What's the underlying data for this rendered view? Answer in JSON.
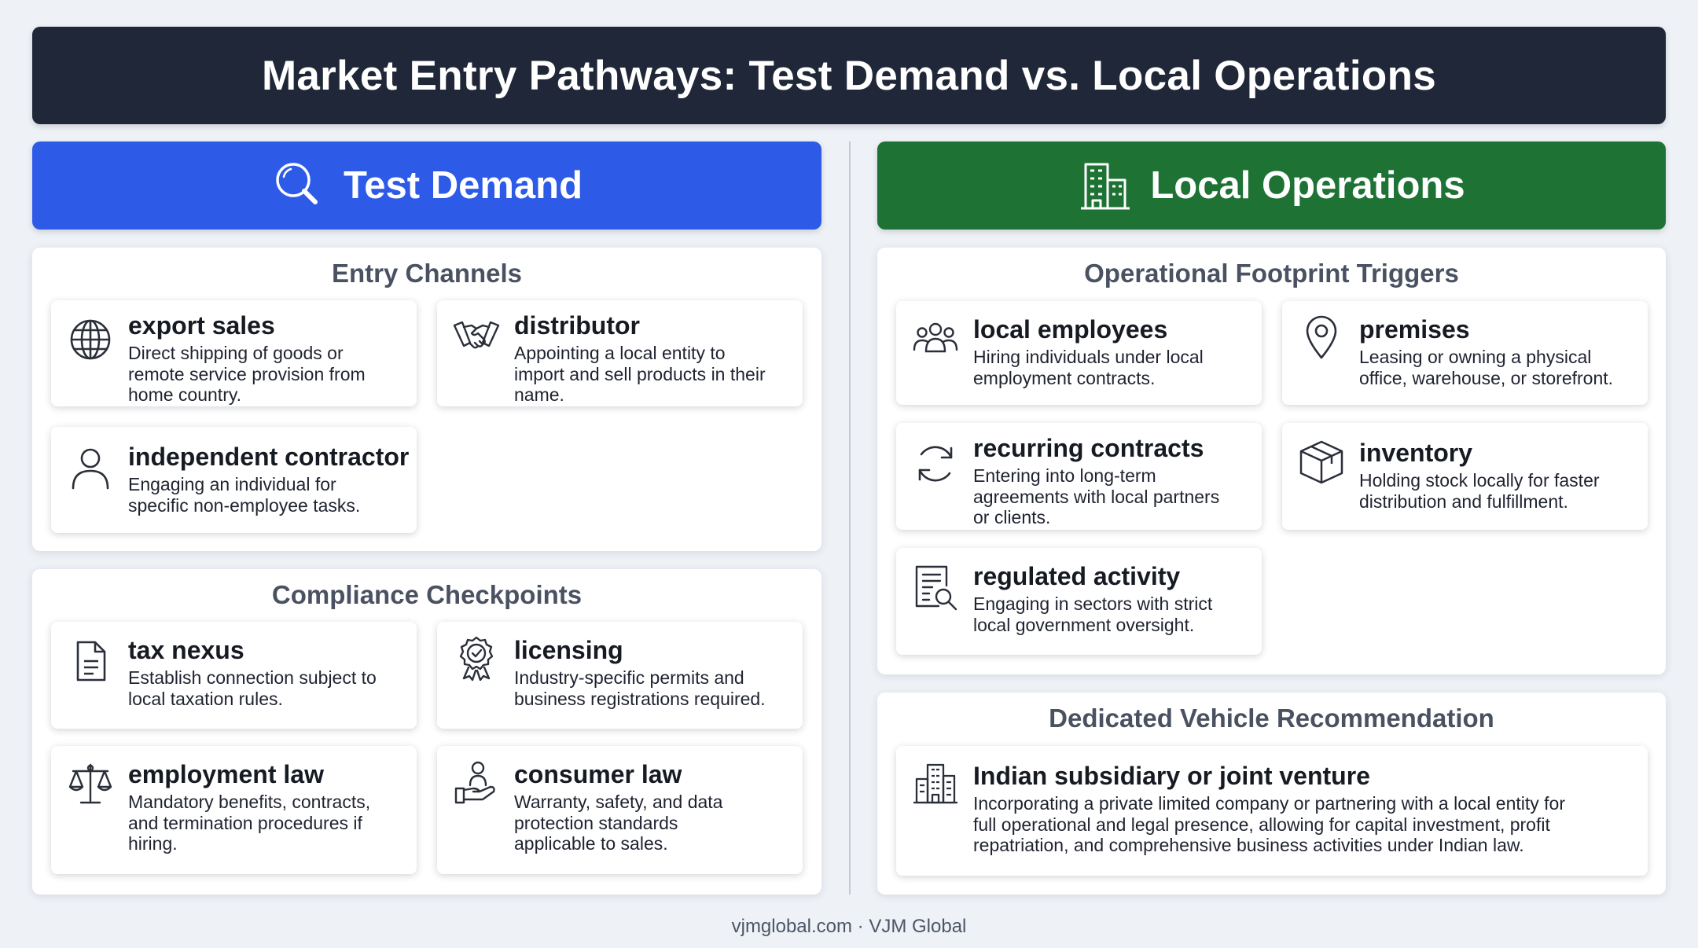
{
  "title": "Market Entry Pathways: Test Demand vs. Local Operations",
  "left_column": {
    "header": "Test Demand",
    "header_icon": "search-icon",
    "header_color": "#2d5be8",
    "entry_channels": {
      "title": "Entry Channels",
      "cards": [
        {
          "icon": "globe-icon",
          "title": "export sales",
          "lines": [
            "Direct shipping of goods or",
            "remote service provision from",
            "home country."
          ]
        },
        {
          "icon": "handshake-icon",
          "title": "distributor",
          "lines": [
            "Appointing a local entity to",
            "import and sell products in their",
            "name."
          ]
        },
        {
          "icon": "person-icon",
          "title": "independent contractor",
          "lines": [
            "Engaging an individual for",
            "specific non-employee tasks."
          ]
        }
      ]
    },
    "compliance_checkpoints": {
      "title": "Compliance Checkpoints",
      "cards": [
        {
          "icon": "document-icon",
          "title": "tax nexus",
          "lines": [
            "Establish connection subject to",
            "local taxation rules."
          ]
        },
        {
          "icon": "badge-icon",
          "title": "licensing",
          "lines": [
            "Industry-specific permits and",
            "business registrations required."
          ]
        },
        {
          "icon": "scales-icon",
          "title": "employment law",
          "lines": [
            "Mandatory benefits, contracts,",
            "and termination procedures if",
            "hiring."
          ]
        },
        {
          "icon": "hand-person-icon",
          "title": "consumer law",
          "lines": [
            "Warranty, safety, and data",
            "protection standards",
            "applicable to sales."
          ]
        }
      ]
    }
  },
  "right_column": {
    "header": "Local Operations",
    "header_icon": "building-icon",
    "header_color": "#1d7234",
    "footprint_triggers": {
      "title": "Operational Footprint Triggers",
      "cards": [
        {
          "icon": "group-icon",
          "title": "local employees",
          "lines": [
            "Hiring individuals under local",
            "employment contracts."
          ]
        },
        {
          "icon": "location-pin-icon",
          "title": "premises",
          "lines": [
            "Leasing or owning a physical",
            "office, warehouse, or storefront."
          ]
        },
        {
          "icon": "refresh-icon",
          "title": "recurring contracts",
          "lines": [
            "Entering into long-term",
            "agreements with local partners",
            "or clients."
          ]
        },
        {
          "icon": "box-icon",
          "title": "inventory",
          "lines": [
            "Holding stock locally for faster",
            "distribution and fulfillment."
          ]
        },
        {
          "icon": "document-search-icon",
          "title": "regulated activity",
          "lines": [
            "Engaging in sectors with strict",
            "local government oversight."
          ]
        }
      ]
    },
    "vehicle_recommendation": {
      "title": "Dedicated Vehicle Recommendation",
      "card": {
        "icon": "office-building-icon",
        "title": "Indian subsidiary or joint venture",
        "lines": [
          "Incorporating a private limited company or partnering with a local entity for",
          "full operational and legal presence, allowing for capital investment, profit",
          "repatriation, and comprehensive business activities under Indian law."
        ]
      }
    }
  },
  "footer": "vjmglobal.com · VJM Global"
}
